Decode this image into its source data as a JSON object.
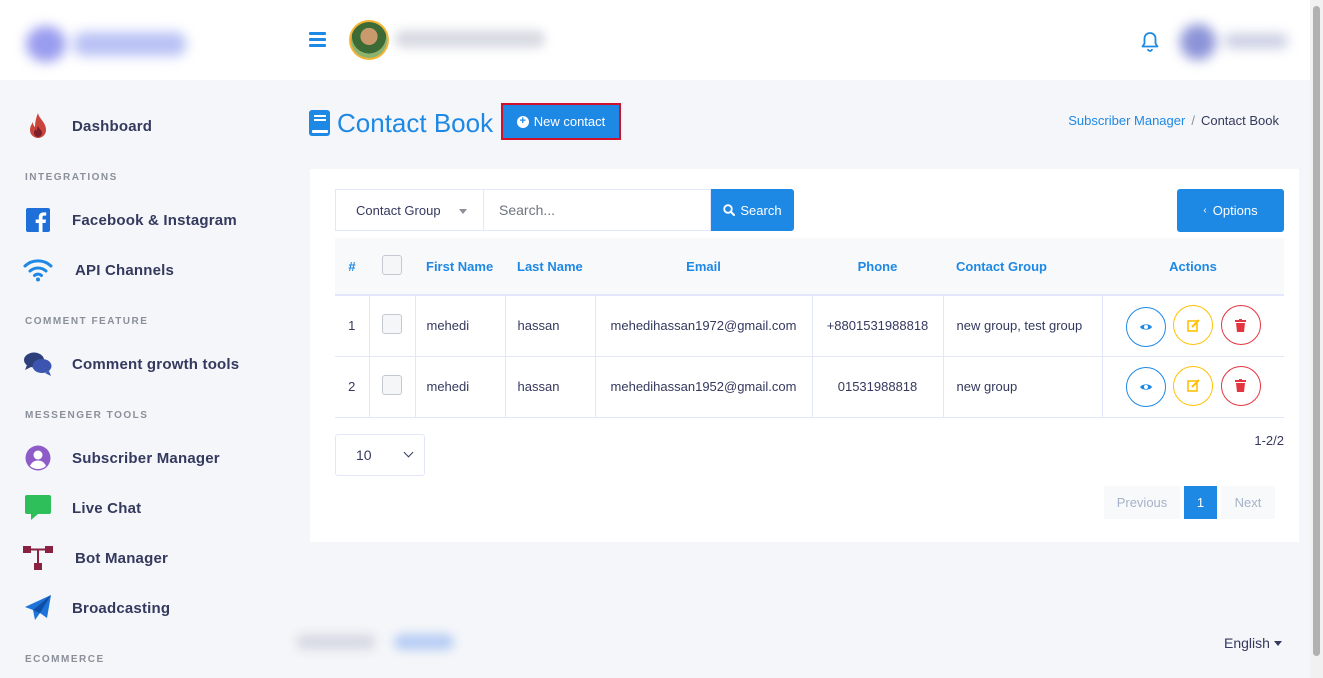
{
  "page": {
    "title": "Contact Book",
    "new_contact_label": "New contact",
    "breadcrumb": {
      "parent": "Subscriber Manager",
      "separator": "/",
      "current": "Contact Book"
    }
  },
  "sidebar": {
    "items": [
      {
        "label": "Dashboard",
        "icon": "flame-icon"
      },
      {
        "section": "INTEGRATIONS"
      },
      {
        "label": "Facebook & Instagram",
        "icon": "facebook-icon"
      },
      {
        "label": "API Channels",
        "icon": "wifi-icon"
      },
      {
        "section": "COMMENT FEATURE"
      },
      {
        "label": "Comment growth tools",
        "icon": "comments-icon"
      },
      {
        "section": "MESSENGER TOOLS"
      },
      {
        "label": "Subscriber Manager",
        "icon": "user-circle-icon"
      },
      {
        "label": "Live Chat",
        "icon": "chat-icon"
      },
      {
        "label": "Bot Manager",
        "icon": "sitemap-icon"
      },
      {
        "label": "Broadcasting",
        "icon": "paper-plane-icon"
      },
      {
        "section": "ECOMMERCE"
      }
    ]
  },
  "toolbar": {
    "group_select": "Contact Group",
    "search_placeholder": "Search...",
    "search_label": "Search",
    "options_label": "Options"
  },
  "table": {
    "columns": [
      "#",
      "",
      "First Name",
      "Last Name",
      "Email",
      "Phone",
      "Contact Group",
      "Actions"
    ],
    "rows": [
      {
        "n": "1",
        "first": "mehedi",
        "last": "hassan",
        "email": "mehedihassan1972@gmail.com",
        "phone": "+8801531988818",
        "group": "new group, test group"
      },
      {
        "n": "2",
        "first": "mehedi",
        "last": "hassan",
        "email": "mehedihassan1952@gmail.com",
        "phone": "01531988818",
        "group": "new group"
      }
    ]
  },
  "pagination": {
    "per_page": "10",
    "range": "1-2/2",
    "previous": "Previous",
    "current_page": "1",
    "next": "Next"
  },
  "footer": {
    "language": "English"
  },
  "colors": {
    "primary": "#1e88e5",
    "warning": "#ffc107",
    "danger": "#e3353f",
    "highlight_border": "#d0112b"
  }
}
